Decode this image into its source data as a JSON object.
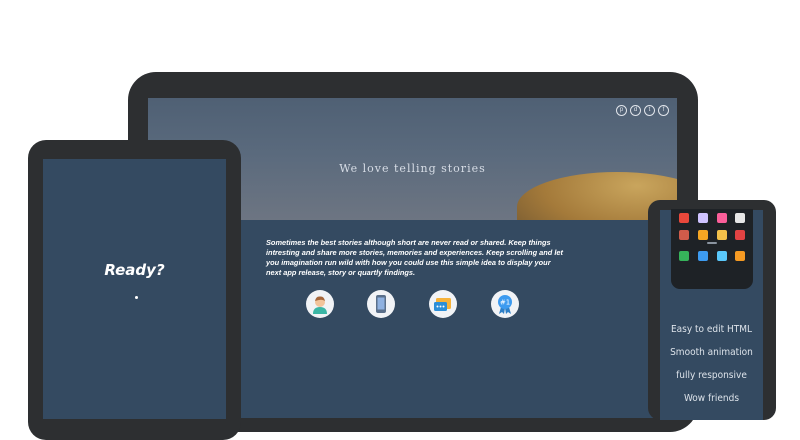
{
  "hero": {
    "title": "We love telling stories",
    "social_icons": [
      "pinterest-icon",
      "dribbble-icon",
      "twitter-icon",
      "facebook-icon"
    ],
    "social_glyphs": [
      "p",
      "d",
      "t",
      "f"
    ]
  },
  "story": {
    "text": "Sometimes the best stories although short are never read or shared. Keep things intresting and share more stories, memories and experiences. Keep scrolling and let you imagination run wild with how you could use this simple idea to display your next app release, story or quartly findings."
  },
  "features": [
    "person-icon",
    "phone-icon",
    "chat-folder-icon",
    "award-icon"
  ],
  "tablet": {
    "title": "Ready?"
  },
  "phone": {
    "apps": [
      "#e9483b",
      "#cfc3ff",
      "#fb5f9a",
      "#e6e6e6",
      "#d05b4a",
      "#f5a623",
      "#f3c14a",
      "#e24343",
      "#36b35a",
      "#3d9bf0",
      "#5ac8fa",
      "#f59a23"
    ],
    "features": [
      "Easy to edit HTML",
      "Smooth animation",
      "fully responsive",
      "Wow friends"
    ]
  },
  "colors": {
    "screen": "#344a61",
    "device": "#2d2f31"
  }
}
